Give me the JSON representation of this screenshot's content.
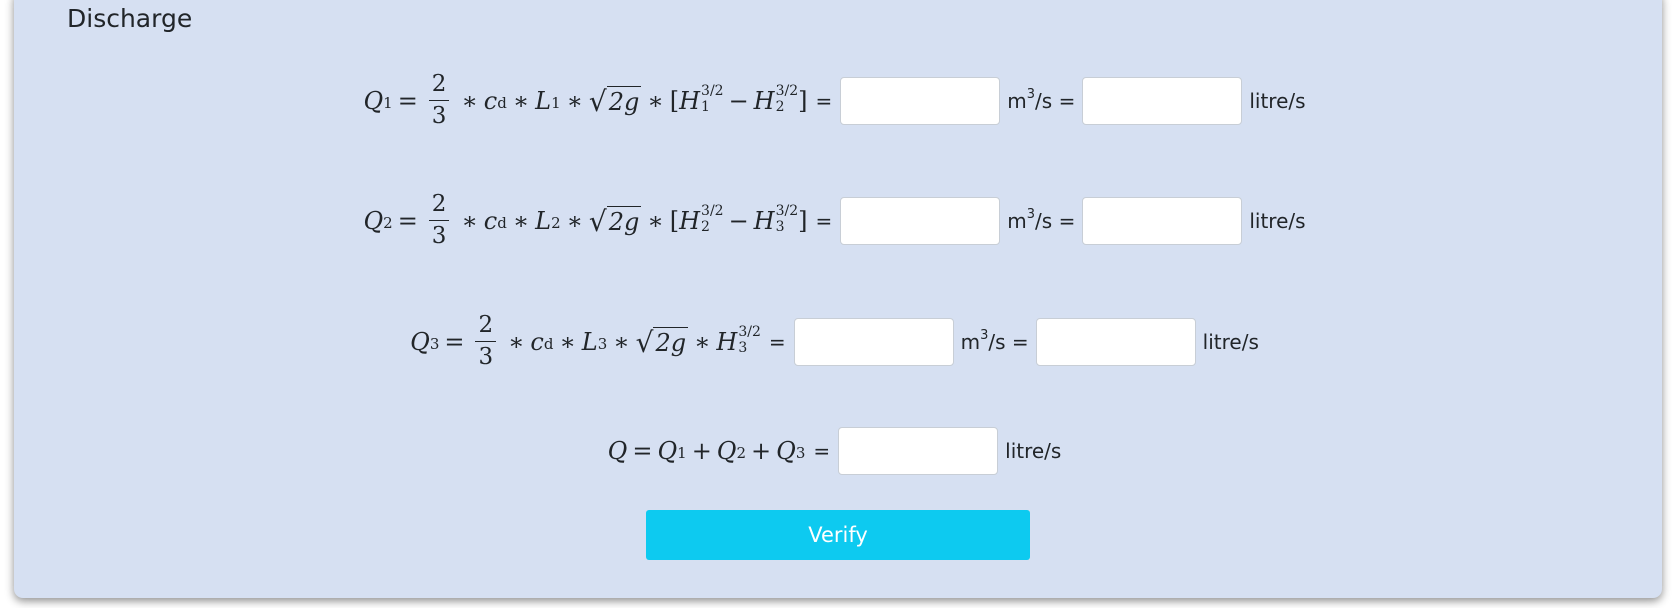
{
  "section": {
    "title": "Discharge"
  },
  "equations": [
    {
      "lhs": "Q",
      "lhs_sub": "1",
      "frac_num": "2",
      "frac_den": "3",
      "coef": "c",
      "coef_sub": "d",
      "length": "L",
      "length_sub": "1",
      "sqrt_arg": "2g",
      "exponent": "3/2",
      "h_a": "H",
      "h_a_sub": "1",
      "minus": "−",
      "h_b": "H",
      "h_b_sub": "2",
      "equals": "=",
      "unit_m3": "m",
      "unit_m3_sup": "3",
      "unit_m3_tail": "/s =",
      "unit_litre": "litre/s",
      "m3_value": "",
      "litre_value": ""
    },
    {
      "lhs": "Q",
      "lhs_sub": "2",
      "frac_num": "2",
      "frac_den": "3",
      "coef": "c",
      "coef_sub": "d",
      "length": "L",
      "length_sub": "2",
      "sqrt_arg": "2g",
      "exponent": "3/2",
      "h_a": "H",
      "h_a_sub": "2",
      "minus": "−",
      "h_b": "H",
      "h_b_sub": "3",
      "equals": "=",
      "unit_m3": "m",
      "unit_m3_sup": "3",
      "unit_m3_tail": "/s =",
      "unit_litre": "litre/s",
      "m3_value": "",
      "litre_value": ""
    },
    {
      "lhs": "Q",
      "lhs_sub": "3",
      "frac_num": "2",
      "frac_den": "3",
      "coef": "c",
      "coef_sub": "d",
      "length": "L",
      "length_sub": "3",
      "sqrt_arg": "2g",
      "exponent": "3/2",
      "h_a": "H",
      "h_a_sub": "3",
      "equals": "=",
      "unit_m3": "m",
      "unit_m3_sup": "3",
      "unit_m3_tail": "/s =",
      "unit_litre": "litre/s",
      "m3_value": "",
      "litre_value": ""
    }
  ],
  "total": {
    "lhs": "Q",
    "q": "Q",
    "sub1": "1",
    "sub2": "2",
    "sub3": "3",
    "plus": "+",
    "equals": "=",
    "unit_litre": "litre/s",
    "litre_value": ""
  },
  "verify_button": {
    "label": "Verify"
  },
  "colors": {
    "card_background": "#d6e0f2",
    "button_background": "#0dcaf0",
    "button_text": "#ffffff"
  }
}
